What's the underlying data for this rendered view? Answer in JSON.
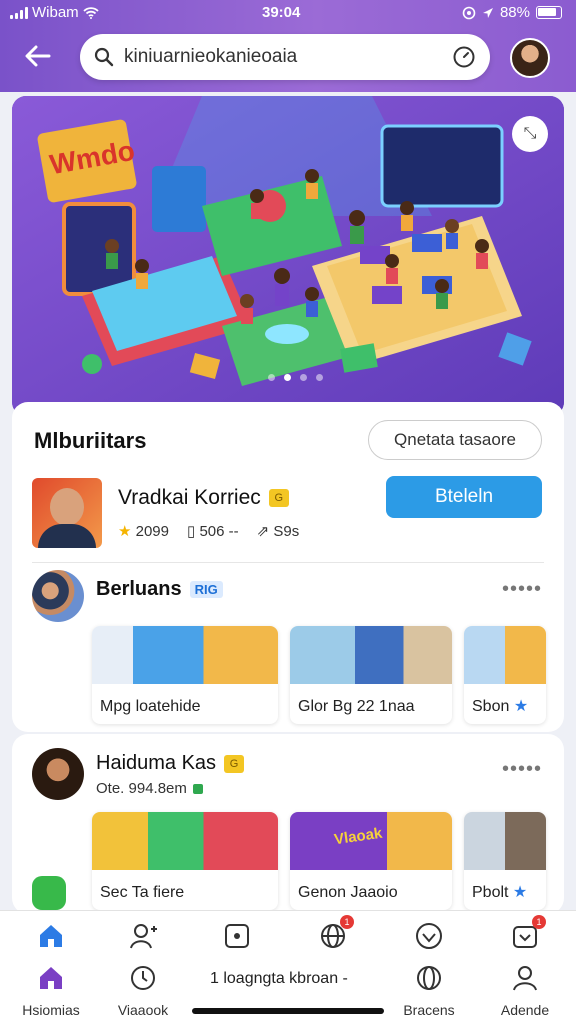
{
  "status_bar": {
    "carrier": "Wibam",
    "time": "39:04",
    "battery": "88%"
  },
  "header": {
    "search_query": "kiniuarnieokanieoaia"
  },
  "hero": {
    "sign_text": "Wmdo",
    "dots": 4,
    "active_dot": 1
  },
  "section": {
    "title": "Mlburiitars",
    "pill_label": "Qnetata tasaore"
  },
  "featured": {
    "name": "Vradkai Korriec",
    "badge": "G",
    "stats": [
      "2099",
      "506 --",
      "S9s"
    ],
    "button_label": "Bteleln"
  },
  "rows": [
    {
      "name": "Berluans",
      "badge": "RIG",
      "tiles": [
        {
          "caption": "Mpg  loatehide"
        },
        {
          "caption": "Glor Bg 22 1naa"
        },
        {
          "caption": "Sbon",
          "star": "★"
        }
      ]
    },
    {
      "name": "Haiduma Kas",
      "badge": "G",
      "subtitle": "Ote. 994.8em",
      "tiles": [
        {
          "caption": "Sec  Ta fiere"
        },
        {
          "caption": "Genon Jaaoio"
        },
        {
          "caption": "Pbolt",
          "star": "★"
        }
      ]
    }
  ],
  "tile_banner_text": "Vlaoak",
  "more_label": "•••••",
  "bottom_label": "1 loagngta kbroan -",
  "nav": [
    {
      "label": "Hsiomias",
      "icon": "home-icon"
    },
    {
      "label": "Viaaook",
      "icon": "clock-icon"
    },
    {
      "label": "",
      "icon": "square-icon"
    },
    {
      "label": "Bracens",
      "icon": "globe-icon"
    },
    {
      "label": "Adende",
      "icon": "person-icon"
    }
  ],
  "nav_top": [
    {
      "icon": "home-icon"
    },
    {
      "icon": "add-person-icon"
    },
    {
      "icon": "square-icon"
    },
    {
      "icon": "globe-icon",
      "badge": "1"
    },
    {
      "icon": "heart-icon"
    },
    {
      "icon": "box-icon",
      "badge": "1"
    }
  ],
  "colors": {
    "accent": "#7a52c9",
    "button": "#2c9be6",
    "active_nav": "#7a3fc4"
  }
}
